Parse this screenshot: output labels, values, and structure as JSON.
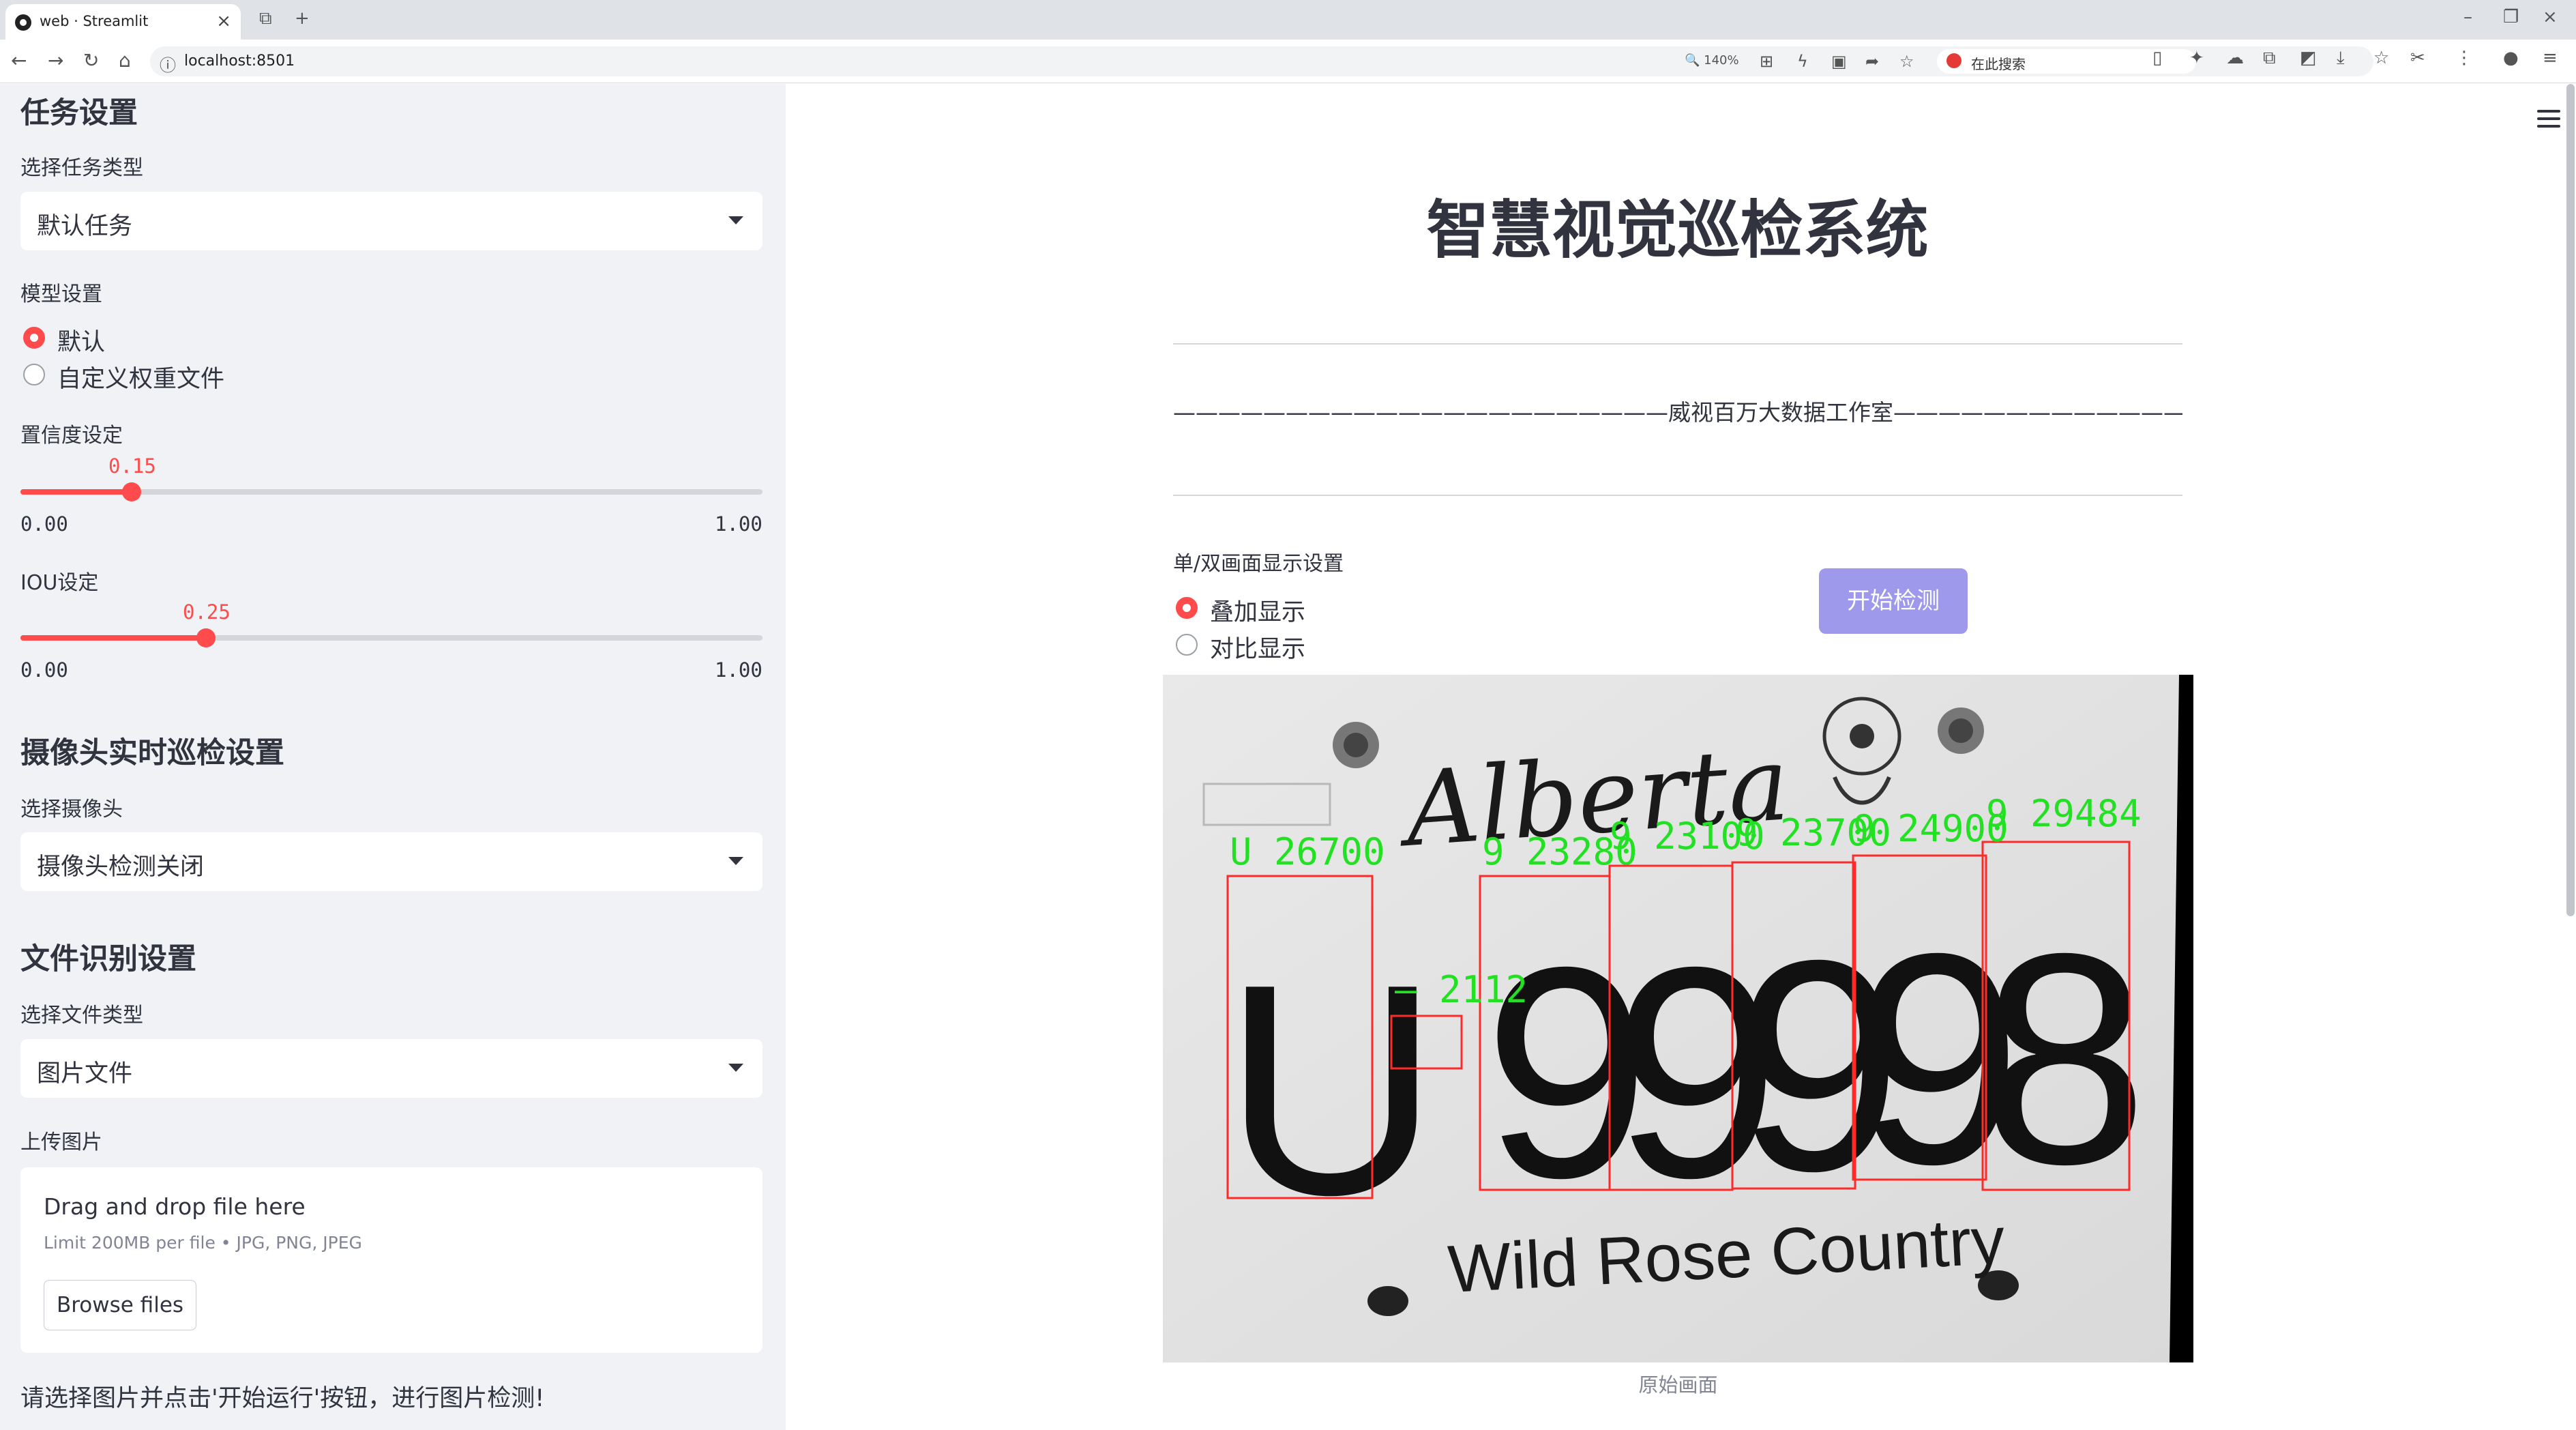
{
  "browser": {
    "tab_title": "web · Streamlit",
    "url": "localhost:8501",
    "zoom": "140%",
    "search_placeholder": "在此搜索"
  },
  "sidebar": {
    "task_header": "任务设置",
    "task_type_label": "选择任务类型",
    "task_type_value": "默认任务",
    "model_label": "模型设置",
    "model_options": [
      "默认",
      "自定义权重文件"
    ],
    "model_selected": "默认",
    "conf_label": "置信度设定",
    "conf_value": "0.15",
    "conf_min": "0.00",
    "conf_max": "1.00",
    "conf_fraction": 0.15,
    "iou_label": "IOU设定",
    "iou_value": "0.25",
    "iou_min": "0.00",
    "iou_max": "1.00",
    "iou_fraction": 0.25,
    "camera_header": "摄像头实时巡检设置",
    "camera_label": "选择摄像头",
    "camera_value": "摄像头检测关闭",
    "file_header": "文件识别设置",
    "file_type_label": "选择文件类型",
    "file_type_value": "图片文件",
    "upload_label": "上传图片",
    "upload_drag": "Drag and drop file here",
    "upload_limit": "Limit 200MB per file • JPG, PNG, JPEG",
    "upload_button": "Browse files",
    "footer_hint": "请选择图片并点击'开始运行'按钮，进行图片检测!"
  },
  "main": {
    "title": "智慧视觉巡检系统",
    "subtitle": "——————————————————————威视百万大数据工作室——————————————————————",
    "display_label": "单/双画面显示设置",
    "display_options": [
      "叠加显示",
      "对比显示"
    ],
    "display_selected": "叠加显示",
    "start_button": "开始检测",
    "image_caption": "原始画面",
    "plate": {
      "province": "Alberta",
      "slogan": "Wild Rose Country",
      "characters": [
        "U",
        "-",
        "9",
        "9",
        "9",
        "9",
        "8"
      ]
    },
    "detections": [
      {
        "label": "U 26700"
      },
      {
        "label": "— 2112"
      },
      {
        "label": "9 23280"
      },
      {
        "label": "9 23100"
      },
      {
        "label": "9 23700"
      },
      {
        "label": "9 24900"
      },
      {
        "label": "9 29484"
      }
    ],
    "box_color": "#ff2a2a",
    "label_color": "#22e022"
  },
  "colors": {
    "accent": "#ff4b4b",
    "button": "#9e99ea",
    "sidebar_bg": "#f0f2f6"
  }
}
